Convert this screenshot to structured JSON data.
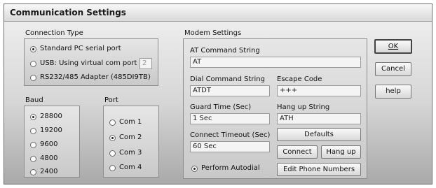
{
  "window": {
    "title": "Communication Settings"
  },
  "connection_type": {
    "heading": "Connection Type",
    "options": [
      {
        "label": "Standard PC serial port",
        "selected": true
      },
      {
        "label": "USB: Using virtual com port #",
        "selected": false
      },
      {
        "label": "RS232/485 Adapter (485DI9TB)",
        "selected": false
      }
    ],
    "com_port_value": "2"
  },
  "baud": {
    "heading": "Baud",
    "options": [
      {
        "label": "28800",
        "selected": true
      },
      {
        "label": "19200",
        "selected": false
      },
      {
        "label": "9600",
        "selected": false
      },
      {
        "label": "4800",
        "selected": false
      },
      {
        "label": "2400",
        "selected": false
      }
    ]
  },
  "port": {
    "heading": "Port",
    "options": [
      {
        "label": "Com 1",
        "selected": false
      },
      {
        "label": "Com 2",
        "selected": true
      },
      {
        "label": "Com 3",
        "selected": false
      },
      {
        "label": "Com 4",
        "selected": false
      }
    ]
  },
  "modem": {
    "heading": "Modem Settings",
    "at_command_label": "AT Command String",
    "at_command_value": "AT",
    "dial_command_label": "Dial Command String",
    "dial_command_value": "ATDT",
    "escape_code_label": "Escape Code",
    "escape_code_value": "+++",
    "guard_time_label": "Guard Time (Sec)",
    "guard_time_value": "1 Sec",
    "hangup_string_label": "Hang up String",
    "hangup_string_value": "ATH",
    "connect_timeout_label": "Connect Timeout (Sec)",
    "connect_timeout_value": "60 Sec",
    "perform_autodial_label": "Perform Autodial",
    "perform_autodial_selected": true,
    "defaults_label": "Defaults",
    "connect_label": "Connect",
    "hangup_label": "Hang up",
    "edit_phone_label": "Edit Phone Numbers"
  },
  "buttons": {
    "ok": "OK",
    "cancel": "Cancel",
    "help": "help"
  }
}
